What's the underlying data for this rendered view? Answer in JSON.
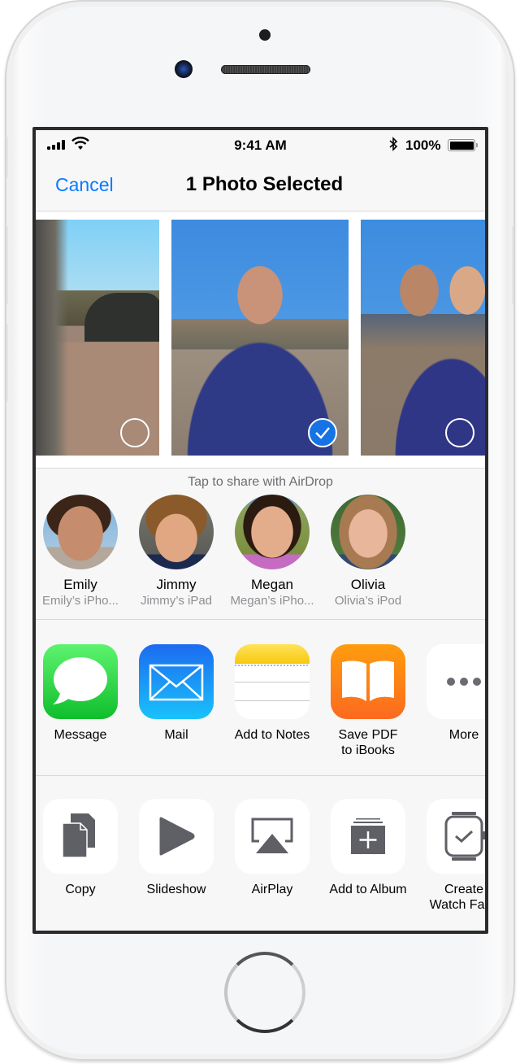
{
  "status_bar": {
    "time": "9:41 AM",
    "battery_percent": "100%",
    "battery_level": 1.0,
    "signal_bars": 4,
    "icons": [
      "signal-icon",
      "wifi-icon",
      "bluetooth-icon",
      "battery-icon"
    ]
  },
  "nav": {
    "cancel_label": "Cancel",
    "title": "1 Photo Selected"
  },
  "photos": [
    {
      "id": "photo-1",
      "description": "Beach with rocks and cliff",
      "selected": false
    },
    {
      "id": "photo-2",
      "description": "Girl blowing bubble on beach",
      "selected": true
    },
    {
      "id": "photo-3",
      "description": "Mother and daughter on beach",
      "selected": false
    }
  ],
  "airdrop": {
    "label": "Tap to share with AirDrop",
    "contacts": [
      {
        "name": "Emily",
        "device": "Emily’s iPho..."
      },
      {
        "name": "Jimmy",
        "device": "Jimmy’s iPad"
      },
      {
        "name": "Megan",
        "device": "Megan’s iPho..."
      },
      {
        "name": "Olivia",
        "device": "Olivia’s iPod"
      }
    ]
  },
  "share_apps": [
    {
      "label": "Message",
      "icon": "message-icon",
      "color": "#1fcf3a"
    },
    {
      "label": "Mail",
      "icon": "mail-icon",
      "color": "#1a8ff5"
    },
    {
      "label": "Add to Notes",
      "icon": "notes-icon",
      "color": "#f8cf1c"
    },
    {
      "label": "Save PDF to iBooks",
      "label_line1": "Save PDF",
      "label_line2": "to iBooks",
      "icon": "ibooks-icon",
      "color": "#fd8317"
    },
    {
      "label": "More",
      "icon": "more-icon",
      "color": "#ffffff"
    }
  ],
  "actions": [
    {
      "label": "Copy",
      "icon": "copy-icon"
    },
    {
      "label": "Slideshow",
      "icon": "play-icon"
    },
    {
      "label": "AirPlay",
      "icon": "airplay-icon"
    },
    {
      "label": "Add to Album",
      "icon": "add-album-icon"
    },
    {
      "label": "Create Watch Face",
      "label_line1": "Create",
      "label_line2": "Watch Face",
      "icon": "watch-icon"
    }
  ],
  "colors": {
    "accent": "#0a7aff",
    "selected_check": "#1673e5",
    "secondary_text": "#8e8e93",
    "action_glyph": "#5f5f66"
  }
}
